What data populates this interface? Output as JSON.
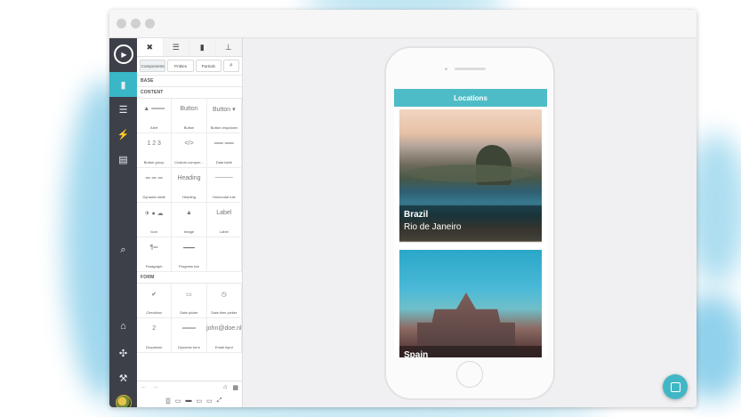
{
  "panel": {
    "tabs": [
      {
        "icon": "tools-icon",
        "glyph": "✖"
      },
      {
        "icon": "database-icon",
        "glyph": "☰"
      },
      {
        "icon": "file-icon",
        "glyph": "▮"
      },
      {
        "icon": "sitemap-icon",
        "glyph": "⊥"
      }
    ],
    "subtabs": [
      "Components",
      "Pritties",
      "Partials"
    ],
    "sections": {
      "base": "BASE",
      "content": "CONTENT",
      "form": "FORM"
    },
    "content_items": [
      {
        "label": "Alert",
        "thumb": "▲ ═══"
      },
      {
        "label": "Button",
        "thumb": "Button"
      },
      {
        "label": "Button dropdown",
        "thumb": "Button ▾"
      },
      {
        "label": "Button group",
        "thumb": "1 2 3"
      },
      {
        "label": "Custom compon...",
        "thumb": "</>"
      },
      {
        "label": "Data table",
        "thumb": "══ ══"
      },
      {
        "label": "Dynamic table",
        "thumb": "═ ═ ═"
      },
      {
        "label": "Heading",
        "thumb": "Heading"
      },
      {
        "label": "Horizontal rule",
        "thumb": "────"
      },
      {
        "label": "Icon",
        "thumb": "✈ ● ☁"
      },
      {
        "label": "Image",
        "thumb": "▲"
      },
      {
        "label": "Label",
        "thumb": "Label"
      },
      {
        "label": "Paragraph",
        "thumb": "¶═"
      },
      {
        "label": "Progress bar",
        "thumb": "━━━"
      },
      {
        "label": "",
        "thumb": ""
      }
    ],
    "form_items": [
      {
        "label": "Checkbox",
        "thumb": "✔"
      },
      {
        "label": "Date picker",
        "thumb": "▭"
      },
      {
        "label": "Date time picker",
        "thumb": "◷"
      },
      {
        "label": "Dropdown",
        "thumb": "2"
      },
      {
        "label": "Dynamic form",
        "thumb": "═══"
      },
      {
        "label": "Email input",
        "thumb": "john@doe.nl"
      }
    ],
    "bottom_icons": [
      "←",
      "→"
    ],
    "device_icons": [
      "▯",
      "▭",
      "▬",
      "▭",
      "▭",
      "⤢"
    ]
  },
  "rail": {
    "items": [
      "play-icon",
      "page-icon",
      "database-icon",
      "bolt-icon",
      "server-icon",
      "search-icon",
      "store-icon",
      "sitemap-icon",
      "tools-icon",
      "avatar"
    ]
  },
  "phone": {
    "app_title": "Locations",
    "cards": [
      {
        "country": "Brazil",
        "city": "Rio de Janeiro"
      },
      {
        "country": "Spain",
        "city": ""
      }
    ]
  },
  "colors": {
    "accent": "#39b7c7",
    "appbar": "#4ebcc6",
    "rail": "#3d4049"
  }
}
